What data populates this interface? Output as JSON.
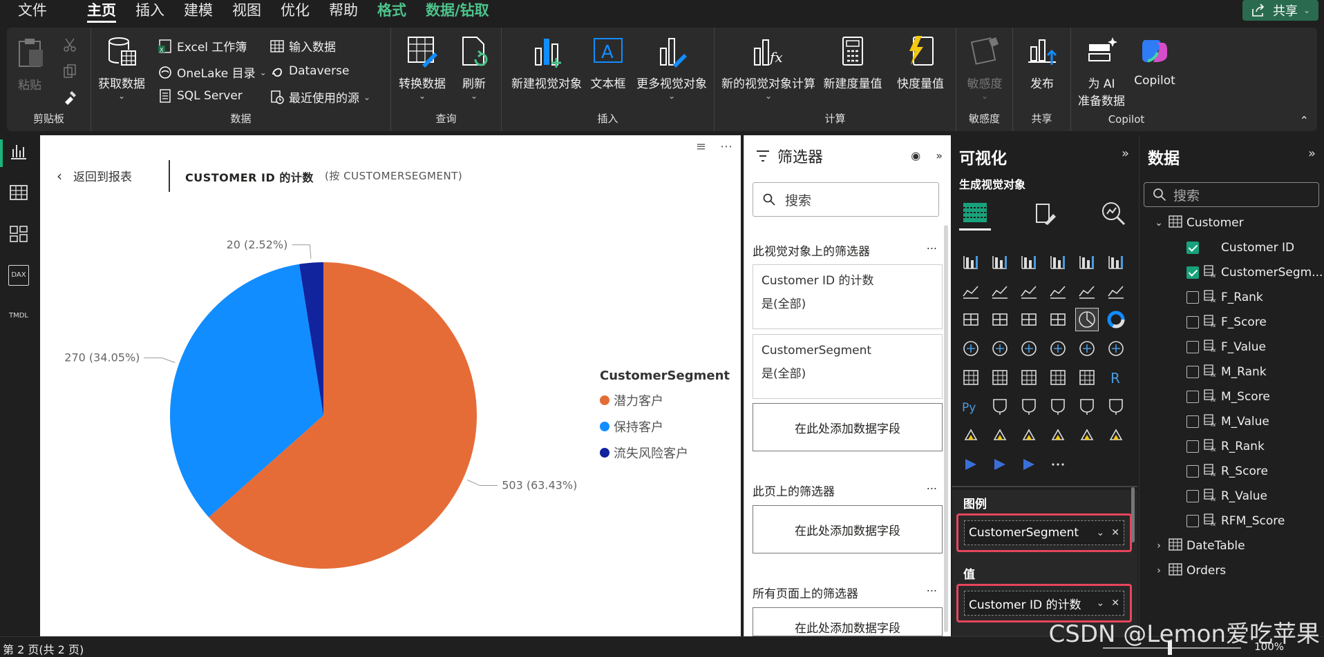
{
  "menubar": {
    "items": [
      "文件",
      "主页",
      "插入",
      "建模",
      "视图",
      "优化",
      "帮助",
      "格式",
      "数据/钻取"
    ],
    "share": "共享"
  },
  "ribbon": {
    "clipboard": {
      "paste": "粘贴",
      "label": "剪贴板"
    },
    "data": {
      "get_data": "获取数据",
      "excel": "Excel 工作簿",
      "onelake": "OneLake 目录",
      "sql": "SQL Server",
      "enter_data": "输入数据",
      "dataverse": "Dataverse",
      "recent": "最近使用的源",
      "label": "数据"
    },
    "query": {
      "transform": "转换数据",
      "refresh": "刷新",
      "label": "查询"
    },
    "insert": {
      "new_visual": "新建视觉对象",
      "textbox": "文本框",
      "more_visuals": "更多视觉对象",
      "label": "插入"
    },
    "calc": {
      "new_visual_calc": "新的视觉对象计算",
      "new_measure": "新建度量值",
      "quick_measure": "快度量值",
      "label": "计算"
    },
    "sensitivity": {
      "btn": "敏感度",
      "label": "敏感度"
    },
    "share": {
      "publish": "发布",
      "label": "共享"
    },
    "copilot": {
      "ai_prep_line1": "为 AI",
      "ai_prep_line2": "准备数据",
      "copilot": "Copilot",
      "label": "Copilot"
    }
  },
  "leftrail": {
    "dax": "DAX",
    "tmdl": "TMDL"
  },
  "canvas": {
    "back": "返回到报表",
    "title": "CUSTOMER ID 的计数",
    "by": "(按 CUSTOMERSEGMENT)",
    "legend_title": "CustomerSegment"
  },
  "chart_data": {
    "type": "pie",
    "title": "CUSTOMER ID 的计数",
    "slices": [
      {
        "name": "潜力客户",
        "value": 503,
        "label": "503 (63.43%)",
        "color": "#E66C37"
      },
      {
        "name": "保持客户",
        "value": 270,
        "label": "270 (34.05%)",
        "color": "#118DFF"
      },
      {
        "name": "流失风险客户",
        "value": 20,
        "label": "20 (2.52%)",
        "color": "#12239E"
      }
    ],
    "legend_placement": "right"
  },
  "filters": {
    "title": "筛选器",
    "search_placeholder": "搜索",
    "visual_section": "此视觉对象上的筛选器",
    "card1_field": "Customer ID 的计数",
    "card1_value": "是(全部)",
    "card2_field": "CustomerSegment",
    "card2_value": "是(全部)",
    "add_field": "在此处添加数据字段",
    "page_section": "此页上的筛选器",
    "all_section": "所有页面上的筛选器",
    "more": "..."
  },
  "viz": {
    "title": "可视化",
    "subtitle": "生成视觉对象",
    "legend_label": "图例",
    "legend_field": "CustomerSegment",
    "values_label": "值",
    "values_field": "Customer ID 的计数",
    "more": "..."
  },
  "data_pane": {
    "title": "数据",
    "search_placeholder": "搜索",
    "tables": [
      {
        "name": "Customer",
        "expanded": true,
        "fields": [
          {
            "name": "Customer ID",
            "checked": true,
            "measure": false
          },
          {
            "name": "CustomerSegm...",
            "checked": true,
            "measure": true
          },
          {
            "name": "F_Rank",
            "checked": false,
            "measure": true
          },
          {
            "name": "F_Score",
            "checked": false,
            "measure": true
          },
          {
            "name": "F_Value",
            "checked": false,
            "measure": true
          },
          {
            "name": "M_Rank",
            "checked": false,
            "measure": true
          },
          {
            "name": "M_Score",
            "checked": false,
            "measure": true
          },
          {
            "name": "M_Value",
            "checked": false,
            "measure": true
          },
          {
            "name": "R_Rank",
            "checked": false,
            "measure": true
          },
          {
            "name": "R_Score",
            "checked": false,
            "measure": true
          },
          {
            "name": "R_Value",
            "checked": false,
            "measure": true
          },
          {
            "name": "RFM_Score",
            "checked": false,
            "measure": true
          }
        ]
      },
      {
        "name": "DateTable",
        "expanded": false,
        "fields": []
      },
      {
        "name": "Orders",
        "expanded": false,
        "fields": []
      }
    ]
  },
  "statusbar": {
    "page": "第 2 页(共 2 页)",
    "zoom": "100%"
  },
  "watermark": "CSDN @Lemon爱吃苹果",
  "colors": {
    "accent": "#18A27B",
    "highlight": "#E8455D"
  }
}
